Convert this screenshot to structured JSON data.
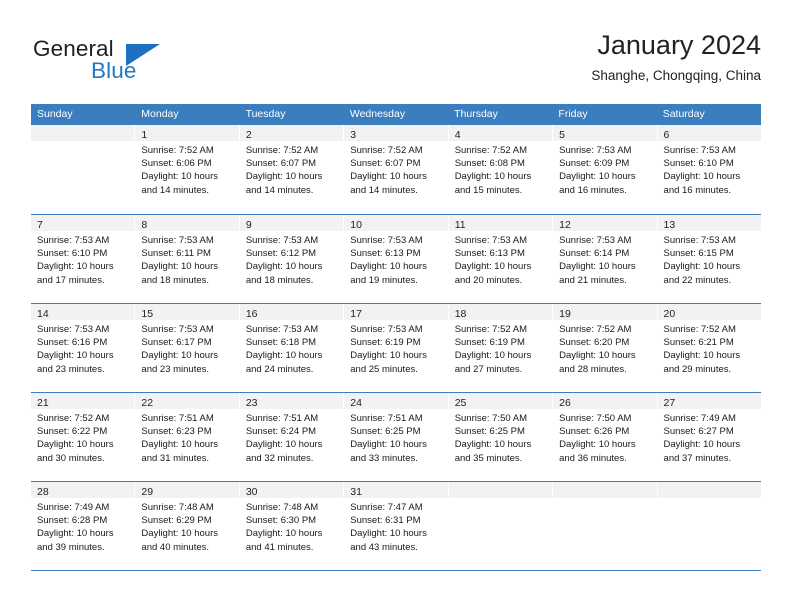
{
  "brand": {
    "word_one": "General",
    "word_two": "Blue",
    "accent_color": "#1f7ac4"
  },
  "header": {
    "title": "January 2024",
    "subtitle": "Shanghe, Chongqing, China"
  },
  "theme": {
    "header_bar_color": "#3a7ebf",
    "day_number_bg": "#f2f2f2",
    "text_color": "#1a1a1a"
  },
  "weekday_headers": [
    "Sunday",
    "Monday",
    "Tuesday",
    "Wednesday",
    "Thursday",
    "Friday",
    "Saturday"
  ],
  "weeks": [
    [
      {
        "day": "",
        "lines": []
      },
      {
        "day": "1",
        "lines": [
          "Sunrise: 7:52 AM",
          "Sunset: 6:06 PM",
          "Daylight: 10 hours",
          "and 14 minutes."
        ]
      },
      {
        "day": "2",
        "lines": [
          "Sunrise: 7:52 AM",
          "Sunset: 6:07 PM",
          "Daylight: 10 hours",
          "and 14 minutes."
        ]
      },
      {
        "day": "3",
        "lines": [
          "Sunrise: 7:52 AM",
          "Sunset: 6:07 PM",
          "Daylight: 10 hours",
          "and 14 minutes."
        ]
      },
      {
        "day": "4",
        "lines": [
          "Sunrise: 7:52 AM",
          "Sunset: 6:08 PM",
          "Daylight: 10 hours",
          "and 15 minutes."
        ]
      },
      {
        "day": "5",
        "lines": [
          "Sunrise: 7:53 AM",
          "Sunset: 6:09 PM",
          "Daylight: 10 hours",
          "and 16 minutes."
        ]
      },
      {
        "day": "6",
        "lines": [
          "Sunrise: 7:53 AM",
          "Sunset: 6:10 PM",
          "Daylight: 10 hours",
          "and 16 minutes."
        ]
      }
    ],
    [
      {
        "day": "7",
        "lines": [
          "Sunrise: 7:53 AM",
          "Sunset: 6:10 PM",
          "Daylight: 10 hours",
          "and 17 minutes."
        ]
      },
      {
        "day": "8",
        "lines": [
          "Sunrise: 7:53 AM",
          "Sunset: 6:11 PM",
          "Daylight: 10 hours",
          "and 18 minutes."
        ]
      },
      {
        "day": "9",
        "lines": [
          "Sunrise: 7:53 AM",
          "Sunset: 6:12 PM",
          "Daylight: 10 hours",
          "and 18 minutes."
        ]
      },
      {
        "day": "10",
        "lines": [
          "Sunrise: 7:53 AM",
          "Sunset: 6:13 PM",
          "Daylight: 10 hours",
          "and 19 minutes."
        ]
      },
      {
        "day": "11",
        "lines": [
          "Sunrise: 7:53 AM",
          "Sunset: 6:13 PM",
          "Daylight: 10 hours",
          "and 20 minutes."
        ]
      },
      {
        "day": "12",
        "lines": [
          "Sunrise: 7:53 AM",
          "Sunset: 6:14 PM",
          "Daylight: 10 hours",
          "and 21 minutes."
        ]
      },
      {
        "day": "13",
        "lines": [
          "Sunrise: 7:53 AM",
          "Sunset: 6:15 PM",
          "Daylight: 10 hours",
          "and 22 minutes."
        ]
      }
    ],
    [
      {
        "day": "14",
        "lines": [
          "Sunrise: 7:53 AM",
          "Sunset: 6:16 PM",
          "Daylight: 10 hours",
          "and 23 minutes."
        ]
      },
      {
        "day": "15",
        "lines": [
          "Sunrise: 7:53 AM",
          "Sunset: 6:17 PM",
          "Daylight: 10 hours",
          "and 23 minutes."
        ]
      },
      {
        "day": "16",
        "lines": [
          "Sunrise: 7:53 AM",
          "Sunset: 6:18 PM",
          "Daylight: 10 hours",
          "and 24 minutes."
        ]
      },
      {
        "day": "17",
        "lines": [
          "Sunrise: 7:53 AM",
          "Sunset: 6:19 PM",
          "Daylight: 10 hours",
          "and 25 minutes."
        ]
      },
      {
        "day": "18",
        "lines": [
          "Sunrise: 7:52 AM",
          "Sunset: 6:19 PM",
          "Daylight: 10 hours",
          "and 27 minutes."
        ]
      },
      {
        "day": "19",
        "lines": [
          "Sunrise: 7:52 AM",
          "Sunset: 6:20 PM",
          "Daylight: 10 hours",
          "and 28 minutes."
        ]
      },
      {
        "day": "20",
        "lines": [
          "Sunrise: 7:52 AM",
          "Sunset: 6:21 PM",
          "Daylight: 10 hours",
          "and 29 minutes."
        ]
      }
    ],
    [
      {
        "day": "21",
        "lines": [
          "Sunrise: 7:52 AM",
          "Sunset: 6:22 PM",
          "Daylight: 10 hours",
          "and 30 minutes."
        ]
      },
      {
        "day": "22",
        "lines": [
          "Sunrise: 7:51 AM",
          "Sunset: 6:23 PM",
          "Daylight: 10 hours",
          "and 31 minutes."
        ]
      },
      {
        "day": "23",
        "lines": [
          "Sunrise: 7:51 AM",
          "Sunset: 6:24 PM",
          "Daylight: 10 hours",
          "and 32 minutes."
        ]
      },
      {
        "day": "24",
        "lines": [
          "Sunrise: 7:51 AM",
          "Sunset: 6:25 PM",
          "Daylight: 10 hours",
          "and 33 minutes."
        ]
      },
      {
        "day": "25",
        "lines": [
          "Sunrise: 7:50 AM",
          "Sunset: 6:25 PM",
          "Daylight: 10 hours",
          "and 35 minutes."
        ]
      },
      {
        "day": "26",
        "lines": [
          "Sunrise: 7:50 AM",
          "Sunset: 6:26 PM",
          "Daylight: 10 hours",
          "and 36 minutes."
        ]
      },
      {
        "day": "27",
        "lines": [
          "Sunrise: 7:49 AM",
          "Sunset: 6:27 PM",
          "Daylight: 10 hours",
          "and 37 minutes."
        ]
      }
    ],
    [
      {
        "day": "28",
        "lines": [
          "Sunrise: 7:49 AM",
          "Sunset: 6:28 PM",
          "Daylight: 10 hours",
          "and 39 minutes."
        ]
      },
      {
        "day": "29",
        "lines": [
          "Sunrise: 7:48 AM",
          "Sunset: 6:29 PM",
          "Daylight: 10 hours",
          "and 40 minutes."
        ]
      },
      {
        "day": "30",
        "lines": [
          "Sunrise: 7:48 AM",
          "Sunset: 6:30 PM",
          "Daylight: 10 hours",
          "and 41 minutes."
        ]
      },
      {
        "day": "31",
        "lines": [
          "Sunrise: 7:47 AM",
          "Sunset: 6:31 PM",
          "Daylight: 10 hours",
          "and 43 minutes."
        ]
      },
      {
        "day": "",
        "lines": []
      },
      {
        "day": "",
        "lines": []
      },
      {
        "day": "",
        "lines": []
      }
    ]
  ]
}
